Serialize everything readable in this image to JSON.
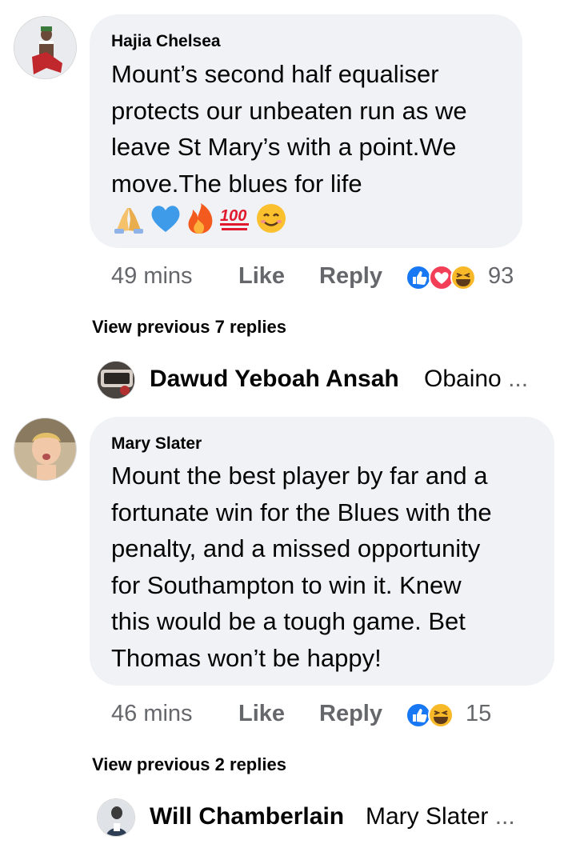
{
  "comments": [
    {
      "author": "Hajia Chelsea",
      "text_lines": [
        "Mount’s second half equaliser",
        "protects our unbeaten run as we",
        "leave St Mary’s with a point.We",
        "move.The blues for life"
      ],
      "emoji_line": [
        "folded-hands",
        "blue-heart",
        "fire",
        "hundred-points",
        "smiling-face"
      ],
      "time": "49 mins",
      "like_label": "Like",
      "reply_label": "Reply",
      "reactions": [
        "like",
        "love",
        "haha"
      ],
      "reaction_count": "93",
      "view_previous": "View previous 7 replies",
      "latest_reply": {
        "author": "Dawud Yeboah Ansah",
        "snippet": "Obaino",
        "ellipsis": "..."
      }
    },
    {
      "author": "Mary Slater",
      "text_lines": [
        "Mount the best player by far and a",
        "fortunate win for the Blues with the",
        "penalty, and a missed opportunity",
        "for Southampton to win it. Knew",
        "this would be a tough game. Bet",
        "Thomas won’t be happy!"
      ],
      "time": "46 mins",
      "like_label": "Like",
      "reply_label": "Reply",
      "reactions": [
        "like",
        "haha"
      ],
      "reaction_count": "15",
      "view_previous": "View previous 2 replies",
      "latest_reply": {
        "author": "Will Chamberlain",
        "snippet": "Mary Slater",
        "ellipsis": "..."
      }
    }
  ],
  "colors": {
    "bubble": "#f0f2f5",
    "meta": "#65676b",
    "like_blue": "#1877f2",
    "love_red": "#f33e58",
    "haha_yellow": "#f7b928"
  }
}
